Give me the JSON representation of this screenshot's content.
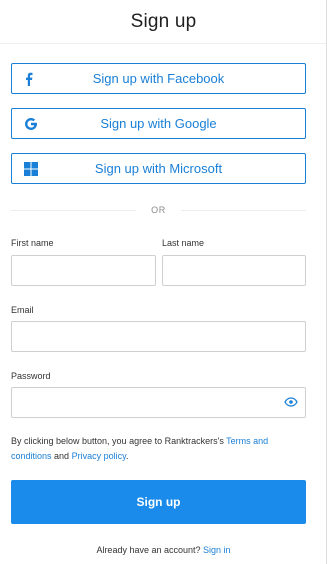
{
  "header": {
    "title": "Sign up"
  },
  "social": {
    "facebook": {
      "label": "Sign up with Facebook",
      "icon": "facebook-icon"
    },
    "google": {
      "label": "Sign up with Google",
      "icon": "google-icon"
    },
    "microsoft": {
      "label": "Sign up with Microsoft",
      "icon": "microsoft-icon"
    }
  },
  "divider": {
    "text": "OR"
  },
  "form": {
    "first_name": {
      "label": "First name",
      "value": "",
      "placeholder": ""
    },
    "last_name": {
      "label": "Last name",
      "value": "",
      "placeholder": ""
    },
    "email": {
      "label": "Email",
      "value": "",
      "placeholder": ""
    },
    "password": {
      "label": "Password",
      "value": "",
      "placeholder": "",
      "toggle_icon": "eye-icon"
    }
  },
  "terms": {
    "prefix": "By clicking below button, you agree to Ranktrackers's",
    "terms_link": "Terms and conditions",
    "middle": "and",
    "privacy_link": "Privacy policy",
    "suffix": "."
  },
  "submit": {
    "label": "Sign up"
  },
  "footer": {
    "prompt": "Already have an account?",
    "signin_link": "Sign in"
  },
  "colors": {
    "accent": "#1a7fd6",
    "button": "#1a8bea",
    "border": "#cfcfcf"
  }
}
